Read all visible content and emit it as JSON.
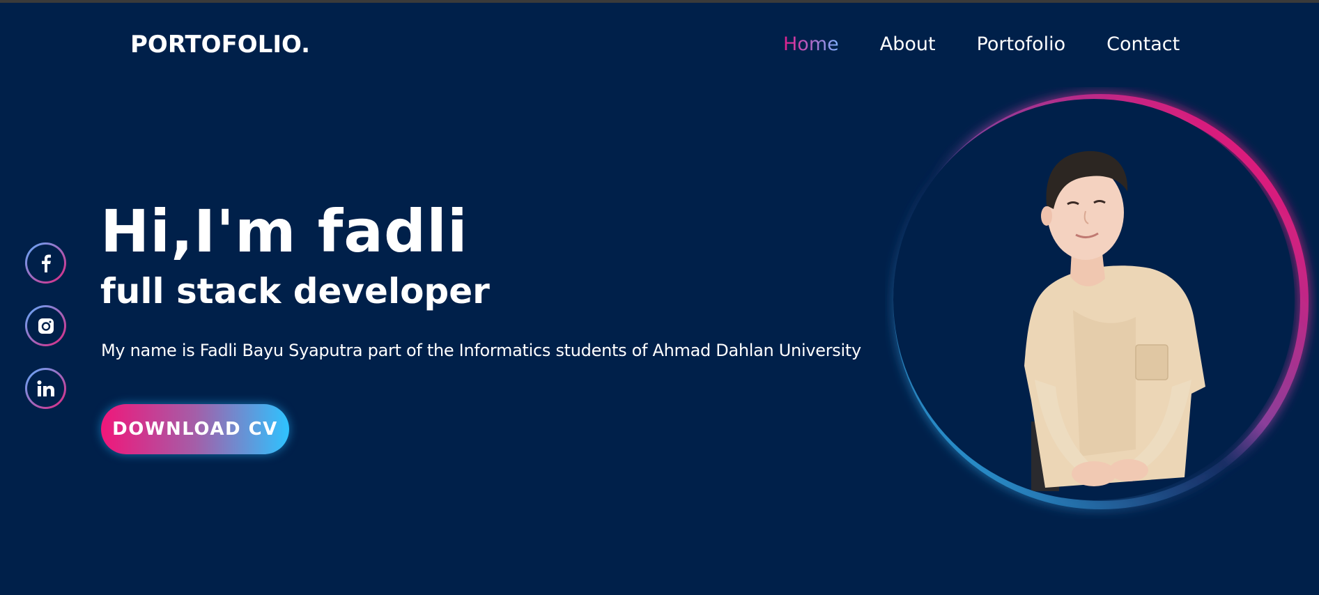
{
  "header": {
    "logo": "PORTOFOLIO.",
    "nav": [
      {
        "label": "Home",
        "active": true
      },
      {
        "label": "About",
        "active": false
      },
      {
        "label": "Portofolio",
        "active": false
      },
      {
        "label": "Contact",
        "active": false
      }
    ]
  },
  "social": [
    {
      "name": "facebook-icon",
      "glyph": "f"
    },
    {
      "name": "instagram-icon",
      "glyph": ""
    },
    {
      "name": "linkedin-icon",
      "glyph": "in"
    }
  ],
  "hero": {
    "title": "Hi,I'm fadli",
    "subtitle": "full stack developer",
    "description": "My name is Fadli Bayu Syaputra part of the Informatics students of Ahmad Dahlan University",
    "cta_label": "DOWNLOAD CV"
  },
  "colors": {
    "background": "#00204a",
    "accent_pink": "#f0177a",
    "accent_blue": "#2ec3ff"
  }
}
